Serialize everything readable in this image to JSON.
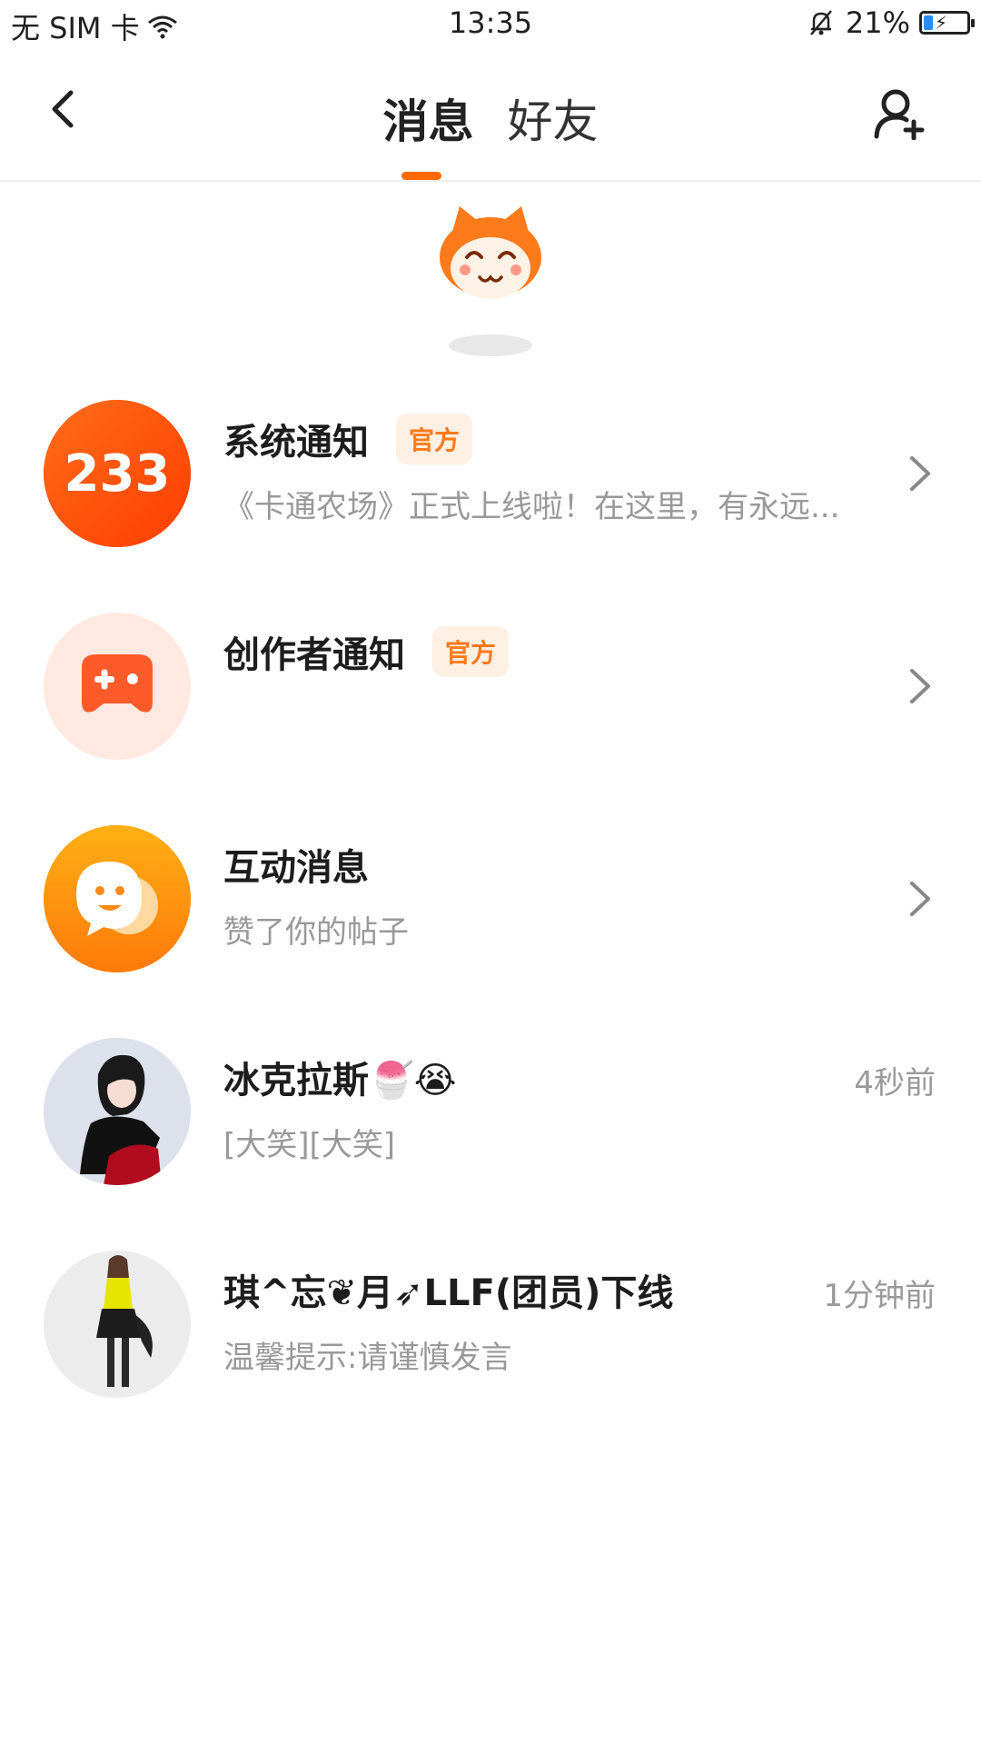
{
  "status_bar": {
    "carrier": "无 SIM 卡",
    "time": "13:35",
    "battery_pct": "21%",
    "battery_level": 0.21
  },
  "header": {
    "tabs": [
      {
        "label": "消息",
        "active": true
      },
      {
        "label": "好友",
        "active": false
      }
    ],
    "accent_color": "#ff6a00"
  },
  "messages": [
    {
      "title": "系统通知",
      "badge": "官方",
      "subtitle": "《卡通农场》正式上线啦！在这里，有永远...",
      "avatar_text": "233"
    },
    {
      "title": "创作者通知",
      "badge": "官方",
      "subtitle": ""
    },
    {
      "title": "互动消息",
      "subtitle": "赞了你的帖子"
    },
    {
      "title": "冰克拉斯🍧😭",
      "subtitle": "[大笑][大笑]",
      "time": "4秒前"
    },
    {
      "title": "琪^忘❦月➶LLF(团员)下线",
      "subtitle": "温馨提示:请谨慎发言",
      "time": "1分钟前"
    }
  ]
}
